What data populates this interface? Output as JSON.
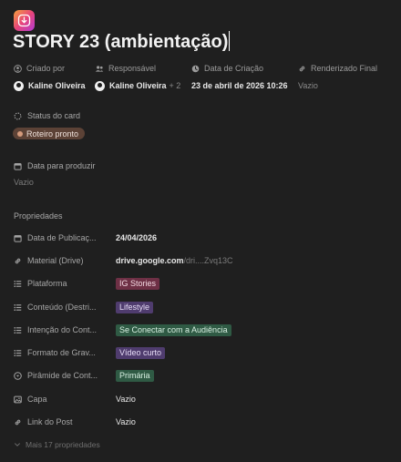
{
  "page": {
    "title": "STORY 23 (ambientação)",
    "icon": "instagram-download-icon"
  },
  "meta": {
    "created_by": {
      "label": "Criado por",
      "value": "Kaline Oliveira"
    },
    "responsible": {
      "label": "Responsável",
      "value": "Kaline Oliveira",
      "extra": "+ 2"
    },
    "created_at": {
      "label": "Data de Criação",
      "value": "23 de abril de 2026 10:26"
    },
    "rendered_final": {
      "label": "Renderizado Final",
      "value": "Vazio"
    }
  },
  "status": {
    "label": "Status do card",
    "value": "Roteiro pronto",
    "color": "#5c4236"
  },
  "produce_date": {
    "label": "Data para produzir",
    "value": "Vazio"
  },
  "properties": {
    "heading": "Propriedades",
    "rows": [
      {
        "name": "Data de Publicaç...",
        "icon": "calendar-icon",
        "value": "24/04/2026"
      },
      {
        "name": "Material (Drive)",
        "icon": "link-icon",
        "host": "drive.google.com",
        "path": "/dri....Zvq13C"
      },
      {
        "name": "Plataforma",
        "icon": "list-icon",
        "tag": "IG Stories",
        "tag_bg": "#6e3045",
        "tag_fg": "#f4d9e2"
      },
      {
        "name": "Conteúdo (Destri...",
        "icon": "list-icon",
        "tag": "Lifestyle",
        "tag_bg": "#4f3c6e",
        "tag_fg": "#e6dcf6"
      },
      {
        "name": "Intenção do Cont...",
        "icon": "list-icon",
        "tag": "Se Conectar com a Audiência",
        "tag_bg": "#2f5a44",
        "tag_fg": "#d8f0e2"
      },
      {
        "name": "Formato de Grav...",
        "icon": "list-icon",
        "tag": "Vídeo curto",
        "tag_bg": "#4f3c6e",
        "tag_fg": "#e6dcf6"
      },
      {
        "name": "Pirâmide de Cont...",
        "icon": "select-icon",
        "tag": "Primária",
        "tag_bg": "#2f5a44",
        "tag_fg": "#d8f0e2"
      },
      {
        "name": "Capa",
        "icon": "image-icon",
        "value": "Vazio"
      },
      {
        "name": "Link do Post",
        "icon": "link-icon",
        "value": "Vazio"
      }
    ]
  },
  "more": "Mais 17 propriedades"
}
